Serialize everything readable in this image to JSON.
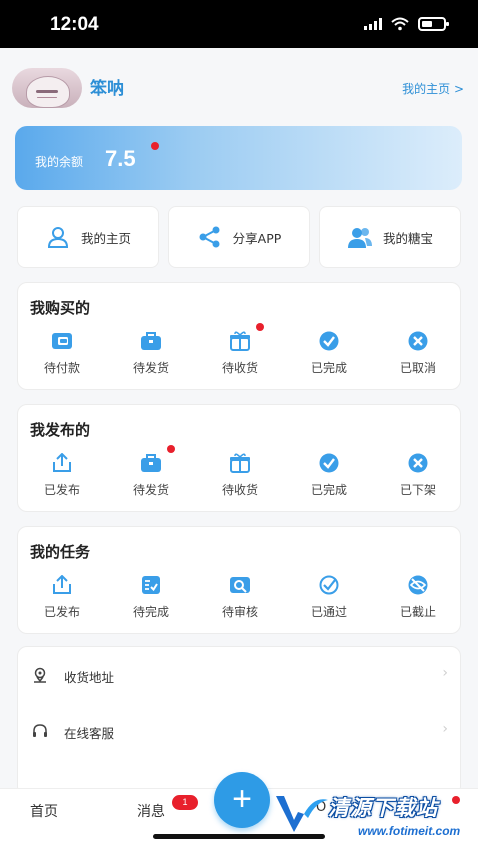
{
  "status_bar": {
    "time": "12:04"
  },
  "profile": {
    "username": "笨呐",
    "homepage_link": "我的主页 >"
  },
  "balance": {
    "label": "我的余额",
    "value": "7.5"
  },
  "quick_actions": [
    {
      "label": "我的主页",
      "icon": "user-icon"
    },
    {
      "label": "分享APP",
      "icon": "share-icon"
    },
    {
      "label": "我的糖宝",
      "icon": "users-icon"
    }
  ],
  "purchased": {
    "title": "我购买的",
    "items": [
      {
        "label": "待付款",
        "icon": "wallet-icon"
      },
      {
        "label": "待发货",
        "icon": "package-icon"
      },
      {
        "label": "待收货",
        "icon": "gift-icon",
        "dot": true
      },
      {
        "label": "已完成",
        "icon": "check-circle-icon"
      },
      {
        "label": "已取消",
        "icon": "cancel-circle-icon"
      }
    ]
  },
  "published": {
    "title": "我发布的",
    "items": [
      {
        "label": "已发布",
        "icon": "upload-icon"
      },
      {
        "label": "待发货",
        "icon": "package-icon",
        "dot": true
      },
      {
        "label": "待收货",
        "icon": "gift-icon"
      },
      {
        "label": "已完成",
        "icon": "check-circle-icon"
      },
      {
        "label": "已下架",
        "icon": "cancel-circle-icon"
      }
    ]
  },
  "tasks": {
    "title": "我的任务",
    "items": [
      {
        "label": "已发布",
        "icon": "upload-icon"
      },
      {
        "label": "待完成",
        "icon": "checklist-icon"
      },
      {
        "label": "待审核",
        "icon": "review-icon"
      },
      {
        "label": "已通过",
        "icon": "check-outline-icon"
      },
      {
        "label": "已截止",
        "icon": "closed-eye-icon"
      }
    ]
  },
  "menu": [
    {
      "label": "收货地址",
      "icon": "location-icon"
    },
    {
      "label": "在线客服",
      "icon": "headset-icon"
    }
  ],
  "tabbar": {
    "home": "首页",
    "messages": "消息",
    "messages_badge": "1",
    "fab": "+",
    "partial": "O"
  },
  "watermark": {
    "name": "清源下载站",
    "url": "www.fotimeit.com"
  },
  "colors": {
    "accent": "#2e9be6",
    "badge": "#e8202c",
    "link": "#2d8fd6"
  }
}
